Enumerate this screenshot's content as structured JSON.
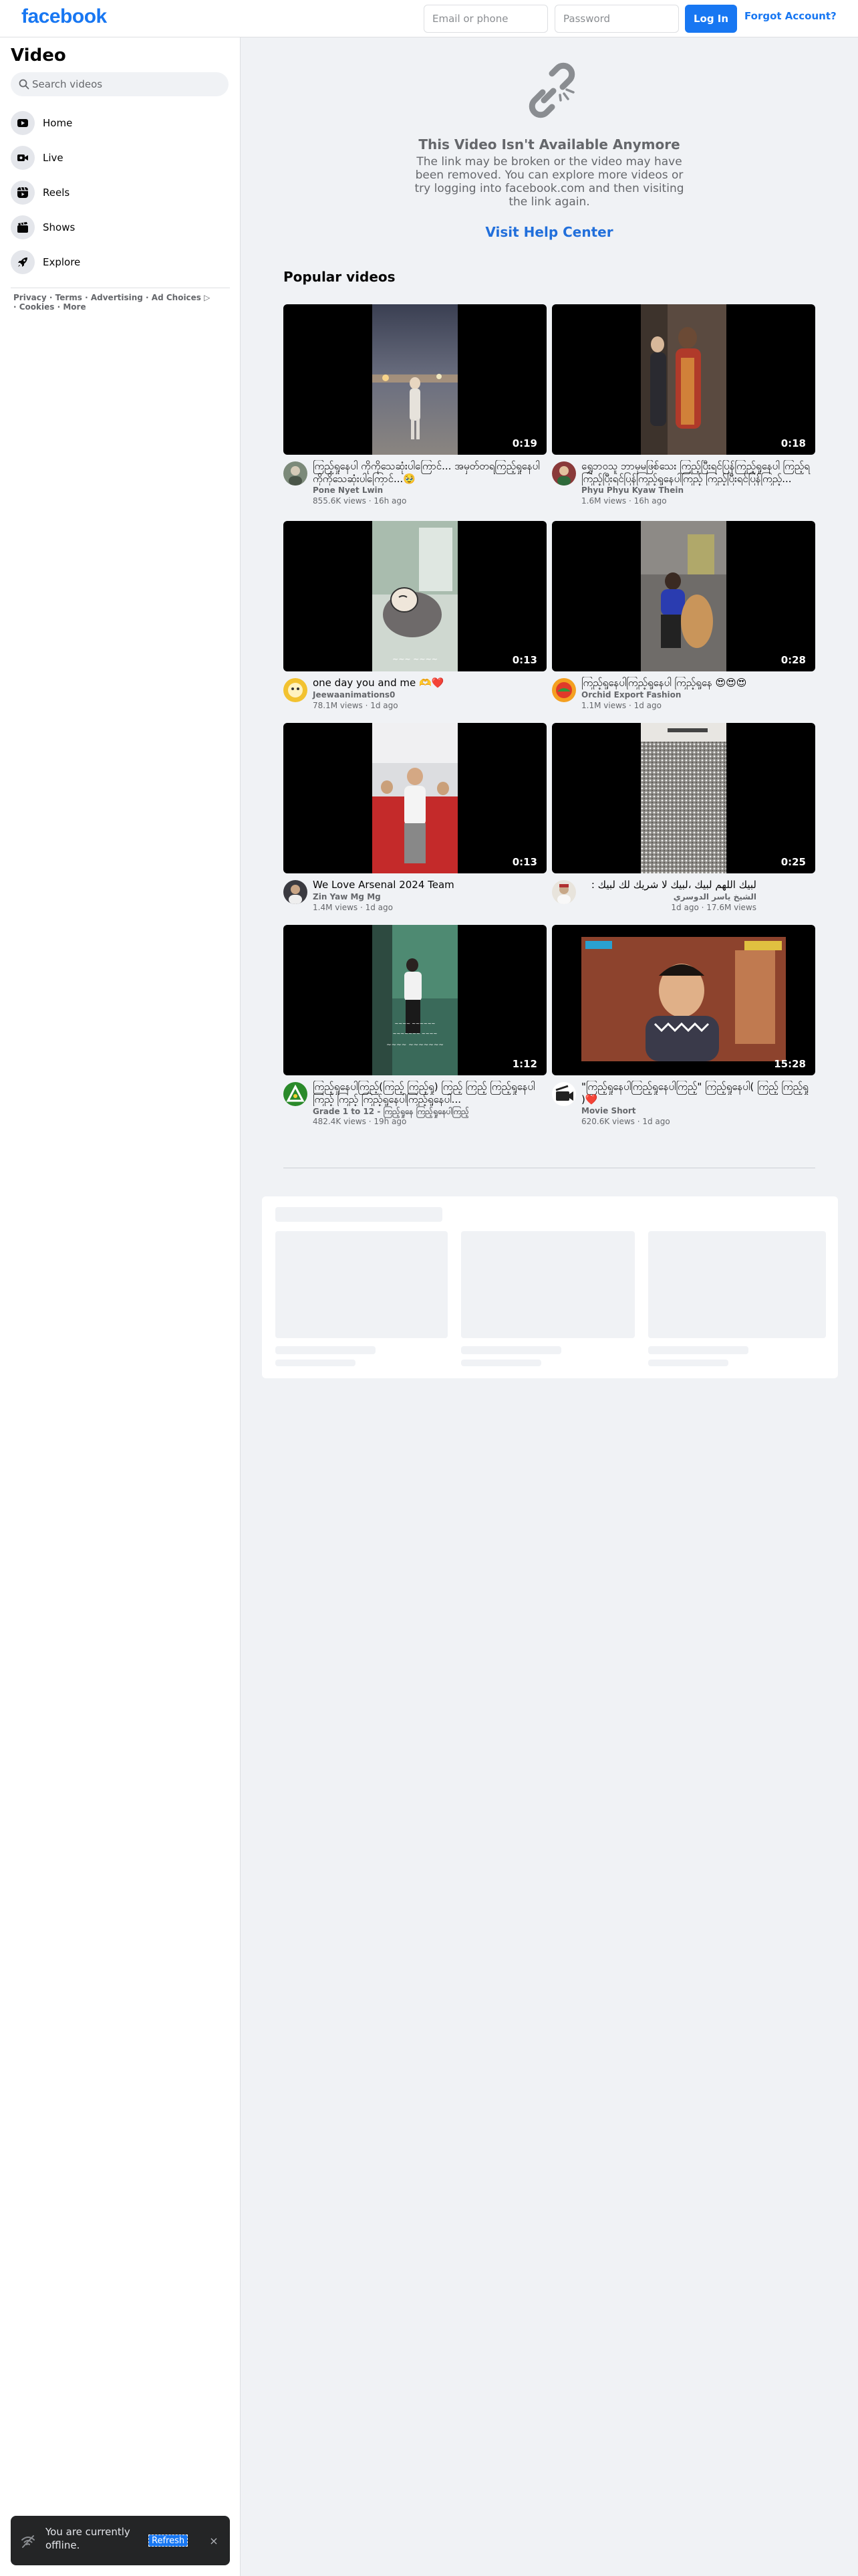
{
  "header": {
    "logo": "facebook",
    "email_placeholder": "Email or phone",
    "password_placeholder": "Password",
    "login_label": "Log In",
    "forgot_label": "Forgot Account?"
  },
  "sidebar": {
    "title": "Video",
    "search_placeholder": "Search videos",
    "items": [
      {
        "label": "Home",
        "icon": "play-icon"
      },
      {
        "label": "Live",
        "icon": "live-camera-icon"
      },
      {
        "label": "Reels",
        "icon": "reels-icon"
      },
      {
        "label": "Shows",
        "icon": "shows-icon"
      },
      {
        "label": "Explore",
        "icon": "rocket-icon"
      }
    ],
    "footer": {
      "privacy": "Privacy",
      "terms": "Terms",
      "advertising": "Advertising",
      "ad_choices": "Ad Choices",
      "cookies": "Cookies",
      "more": "More",
      "sep": "·"
    }
  },
  "unavailable": {
    "title": "This Video Isn't Available Anymore",
    "description": "The link may be broken or the video may have been removed. You can explore more videos or try logging into facebook.com and then visiting the link again.",
    "help_link": "Visit Help Center"
  },
  "popular": {
    "title": "Popular videos",
    "videos": [
      {
        "duration": "0:19",
        "title": "ကြည့်ရှုနေပါ ကိုကိုသေဆုံးပါကြောင်... အမှတ်တရကြည့်ရှုနေပါ ကိုကိုသေဆုံးပါကြောင်...🥹",
        "channel": "Pone Nyet Lwin",
        "stats": "855.6K views · 16h ago"
      },
      {
        "duration": "0:18",
        "title": "ရွှေဘဝသူ ဘာမှမဖြစ်သေး ကြည့်ပြီးရင်ပြန်ကြည့်ရှုနေပါ ကြည့်ရ ကြည့်ပြီးရင်ပြန်ကြည့်ရှုနေပါကြည့် ကြည့်ပြီးရင်ပြန်ကြည့်...",
        "channel": "Phyu Phyu Kyaw Thein",
        "stats": "1.6M views · 16h ago"
      },
      {
        "duration": "0:13",
        "title": "one day you and me 🫶❤️",
        "channel": "Jeewaanimations0",
        "stats": "78.1M views · 1d ago"
      },
      {
        "duration": "0:28",
        "title": "ကြည့်ရှုနေပါကြည့်ရှုနေပါ ကြည့်ရှုနေ 😍😍😍",
        "channel": "Orchid Export Fashion",
        "stats": "1.1M views · 1d ago"
      },
      {
        "duration": "0:13",
        "title": "We Love Arsenal 2024 Team",
        "channel": "Zin Yaw Mg Mg",
        "stats": "1.4M views · 1d ago"
      },
      {
        "duration": "0:25",
        "title": "لبيك اللهم لبيك ،لبيك لا شريك لك لبيك :",
        "channel": "الشيخ ياسر الدوسري",
        "stats": "1d ago · 17.6M views"
      },
      {
        "duration": "1:12",
        "title": "ကြည့်ရှုနေပါကြည့်(ကြည့် ကြည့်ရှု) ကြည့် ကြည့် ကြည့်ရှုနေပါကြည့် ကြည့် ကြည့်ရှုနေပါကြည့်ရှုနေပါ...",
        "channel": "Grade 1 to 12 - ကြည့်ရှုနေ ကြည့်ရှုနေပါကြည့်",
        "stats": "482.4K views · 19h ago"
      },
      {
        "duration": "15:28",
        "title": "\"ကြည့်ရှုနေပါကြည့်ရှုနေပါကြည့်\" ကြည့်ရှုနေပါ( ကြည့် ကြည့်ရှု )❤️",
        "channel": "Movie Short",
        "stats": "620.6K views · 1d ago"
      }
    ]
  },
  "toast": {
    "message": "You are currently offline.",
    "refresh_label": "Refresh",
    "close_label": "×"
  },
  "colors": {
    "brand": "#1877f2",
    "link": "#216fdb",
    "background": "#f0f2f5"
  }
}
